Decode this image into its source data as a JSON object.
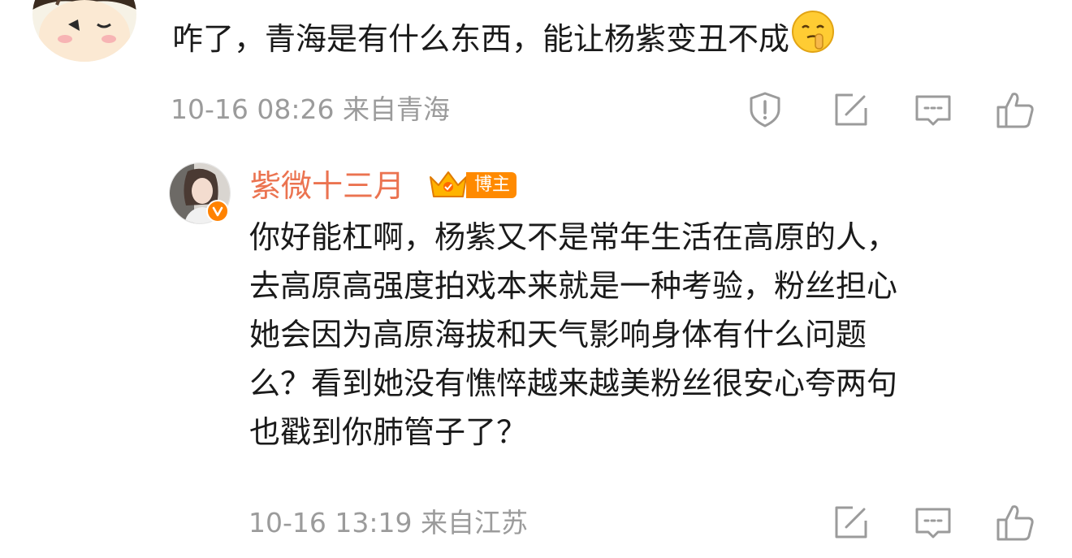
{
  "comment": {
    "text": "咋了，青海是有什么东西，能让杨紫变丑不成",
    "emoji": "shush-face-emoji",
    "time": "10-16 08:26",
    "location": "来自青海",
    "actions": [
      "report-icon",
      "repost-icon",
      "comment-icon",
      "like-icon"
    ]
  },
  "reply": {
    "author": "紫微十三月",
    "badge": "博主",
    "verified_color": "#ff8200",
    "lines": [
      "你好能杠啊，杨紫又不是常年生活在高原的人，",
      "去高原高强度拍戏本来就是一种考验，粉丝担心",
      "她会因为高原海拔和天气影响身体有什么问题",
      "么？看到她没有憔悴越来越美粉丝很安心夸两句",
      "也戳到你肺管子了？"
    ],
    "time": "10-16 13:19",
    "location": "来自江苏",
    "actions": [
      "repost-icon",
      "comment-icon",
      "like-icon"
    ]
  },
  "colors": {
    "name": "#eb7350",
    "meta": "#9b9b9b",
    "badge": "#ff8a00",
    "icon": "#9b9b9b"
  }
}
